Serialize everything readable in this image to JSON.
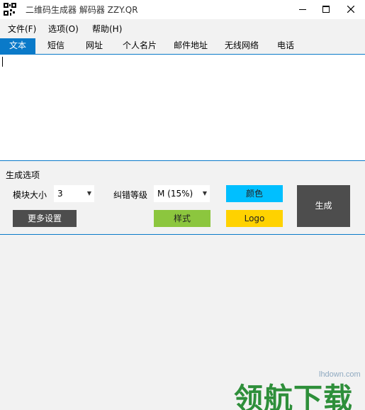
{
  "window": {
    "title": "二维码生成器 解码器 ZZY.QR",
    "minimize_icon": "minimize-icon",
    "maximize_icon": "maximize-icon",
    "close_icon": "close-icon"
  },
  "menu": {
    "items": [
      "文件(F)",
      "选项(O)",
      "帮助(H)"
    ]
  },
  "tabs": {
    "items": [
      "文本",
      "短信",
      "网址",
      "个人名片",
      "邮件地址",
      "无线网络",
      "电话"
    ],
    "active": "文本"
  },
  "editor": {
    "value": ""
  },
  "options": {
    "section_title": "生成选项",
    "module_size_label": "模块大小",
    "module_size_value": "3",
    "error_level_label": "纠错等级",
    "error_level_value": "M (15%)",
    "more_settings": "更多设置",
    "style": "样式",
    "color": "颜色",
    "logo": "Logo",
    "generate": "生成"
  },
  "colors": {
    "accent": "#0a7ac9",
    "dark_button": "#4d4d4d",
    "style_button": "#8cc63e",
    "color_button": "#00bfff",
    "logo_button": "#ffd200"
  },
  "watermark": {
    "site": "lhdown.com",
    "text": "领航下载"
  }
}
